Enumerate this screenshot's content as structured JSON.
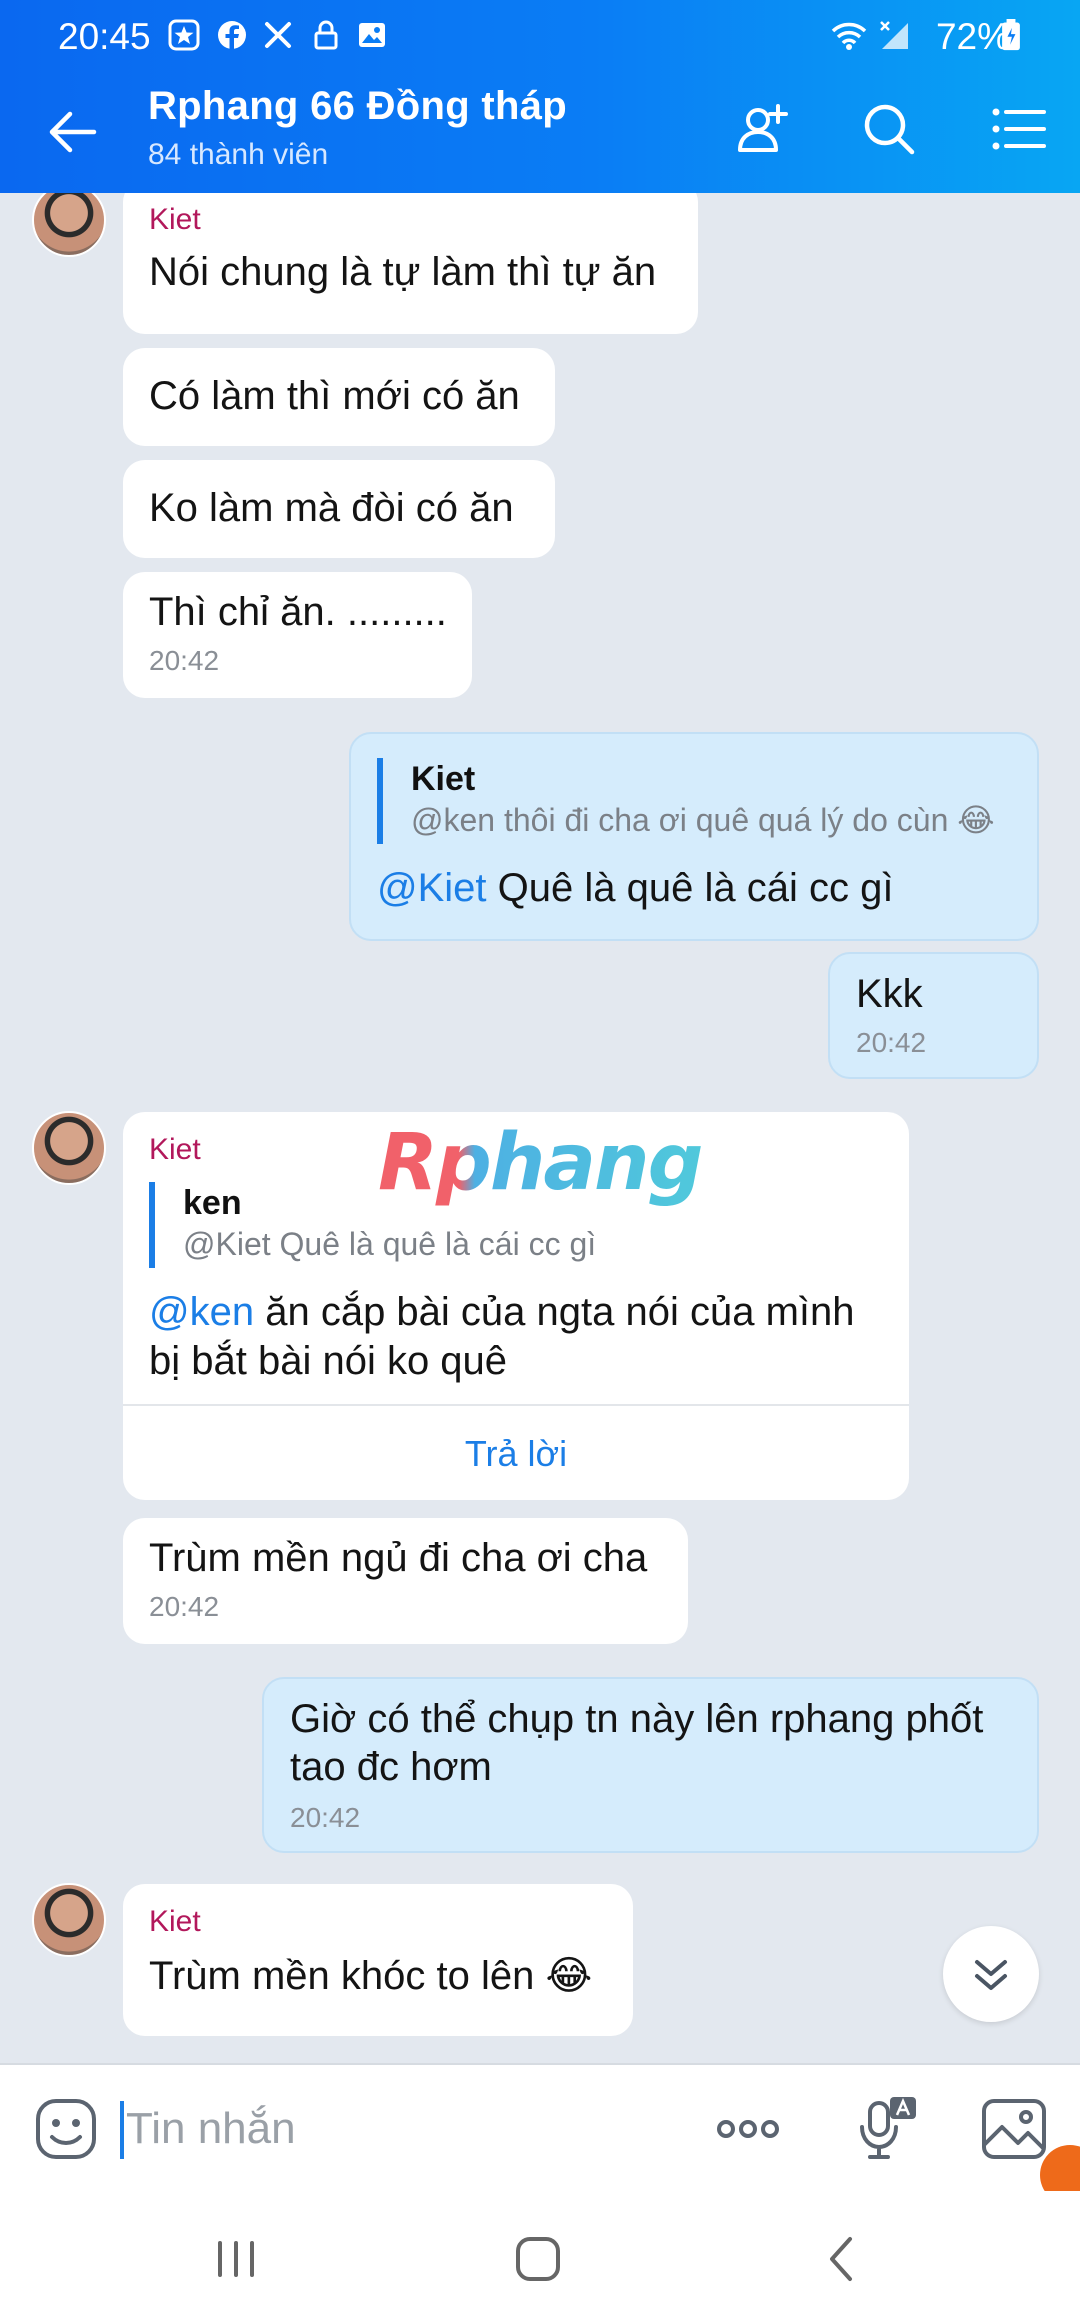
{
  "status_bar": {
    "time": "20:45",
    "battery": "72%",
    "icons": [
      "star-app-icon",
      "facebook-icon",
      "tools-icon",
      "lock-icon",
      "gallery-icon",
      "wifi-icon",
      "no-signal-icon",
      "battery-icon"
    ]
  },
  "header": {
    "title": "Rphang 66 Đồng tháp",
    "subtitle": "84 thành viên",
    "colors": {
      "gradient_start": "#0a68f0",
      "gradient_end": "#08a6f3"
    }
  },
  "messages": {
    "m1": {
      "sender": "Kiet",
      "text": "Nói chung là tự làm thì tự ăn"
    },
    "m2": {
      "text": "Có làm thì mới có ăn"
    },
    "m3": {
      "text": "Ko làm mà đòi có ăn"
    },
    "m4": {
      "text": "Thì chỉ ăn. .........",
      "time": "20:42"
    },
    "m5": {
      "quote_name": "Kiet",
      "quote_text": "@ken thôi đi cha ơi quê quá lý do cùn 😂",
      "mention": "@Kiet",
      "text": " Quê là quê là cái cc gì"
    },
    "m6": {
      "text": "Kkk",
      "time": "20:42"
    },
    "m7": {
      "sender": "Kiet",
      "quote_name": "ken",
      "quote_text": "@Kiet Quê là quê là cái cc gì",
      "mention": "@ken",
      "text_line1": " ăn cắp bài của ngta nói của mình",
      "text_line2": "bị bắt bài nói ko quê",
      "reply_label": "Trả lời"
    },
    "m8": {
      "text": "Trùm mền ngủ đi cha ơi cha",
      "time": "20:42"
    },
    "m9": {
      "text_line1": "Giờ có thể chụp tn này lên rphang phốt",
      "text_line2": "tao đc hơm",
      "time": "20:42"
    },
    "m10": {
      "sender": "Kiet",
      "text": "Trùm mền khóc to lên 😂"
    }
  },
  "watermark": "Rphang",
  "composer": {
    "placeholder": "Tin nhắn",
    "value": ""
  },
  "accent_colors": {
    "mention": "#1b7ee6",
    "sender": "#b2185b",
    "outgoing_bubble": "#d5ecfc"
  }
}
